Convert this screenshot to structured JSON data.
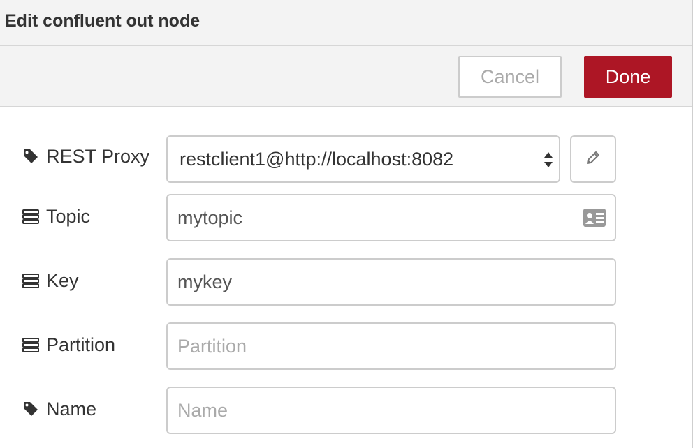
{
  "dialog": {
    "title": "Edit confluent out node"
  },
  "toolbar": {
    "cancel_label": "Cancel",
    "done_label": "Done",
    "done_color": "#ad1625"
  },
  "form": {
    "proxy": {
      "label": "REST Proxy",
      "icon": "tag-icon",
      "selected_value": "restclient1@http://localhost:8082",
      "edit_icon": "pencil-icon"
    },
    "topic": {
      "label": "Topic",
      "icon": "server-icon",
      "value": "mytopic",
      "type_icon": "id-card-icon"
    },
    "key": {
      "label": "Key",
      "icon": "server-icon",
      "value": "mykey"
    },
    "partition": {
      "label": "Partition",
      "icon": "server-icon",
      "value": "",
      "placeholder": "Partition"
    },
    "name": {
      "label": "Name",
      "icon": "tag-icon",
      "value": "",
      "placeholder": "Name"
    }
  }
}
